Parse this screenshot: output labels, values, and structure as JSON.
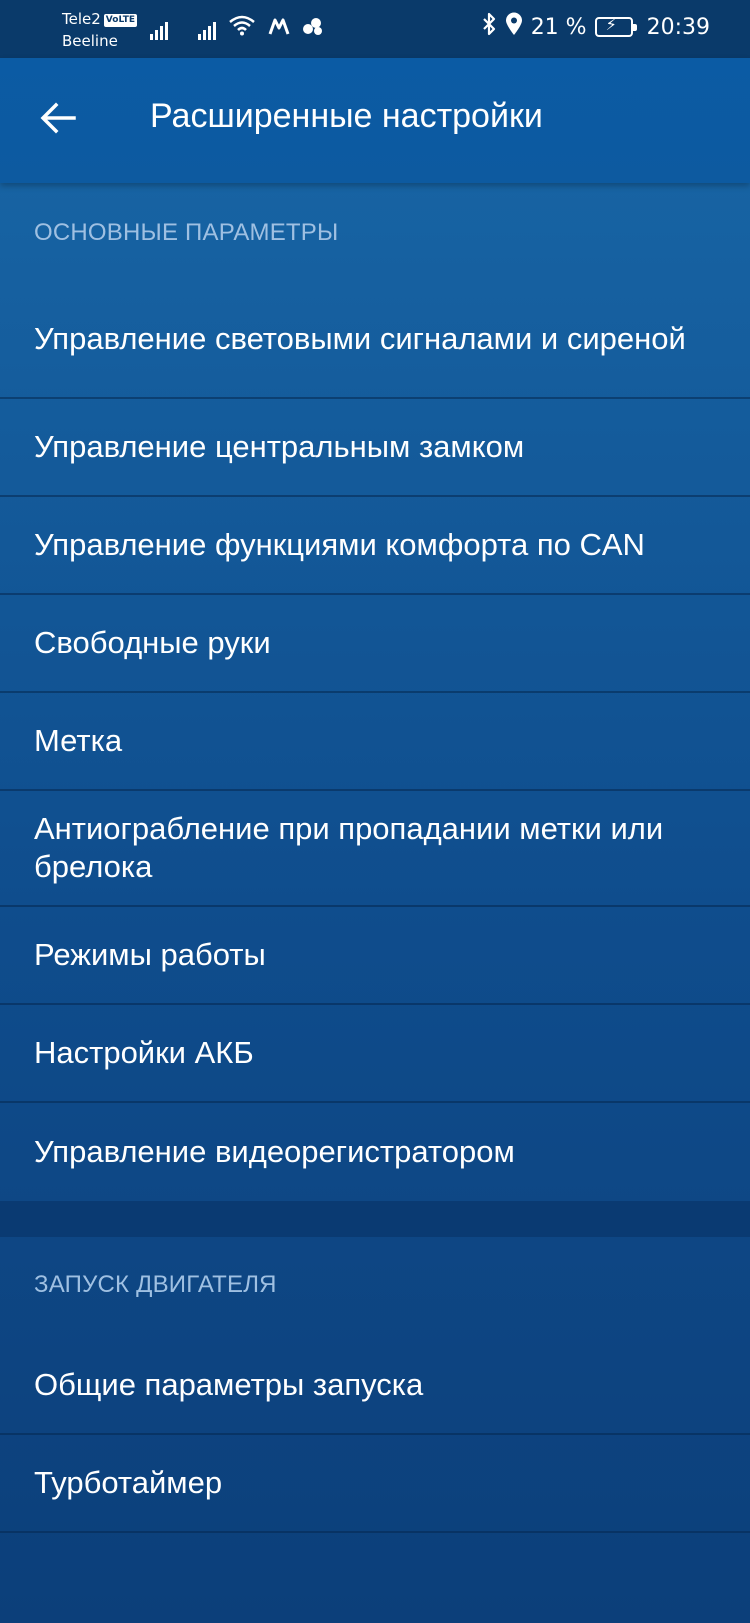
{
  "status_bar": {
    "carrier1": "Tele2",
    "volte": "VoLTE",
    "carrier2": "Beeline",
    "battery_percent": "21 %",
    "time": "20:39",
    "icons": [
      "signal-icon",
      "signal-icon",
      "wifi-icon",
      "m-logo-icon",
      "cloud-icon",
      "bluetooth-icon",
      "location-icon",
      "battery-charging-icon"
    ]
  },
  "appbar": {
    "back_icon": "arrow-left-icon",
    "title": "Расширенные настройки"
  },
  "sections": [
    {
      "header": "ОСНОВНЫЕ ПАРАМЕТРЫ",
      "items": [
        "Управление световыми сигналами и сиреной",
        "Управление центральным замком",
        "Управление функциями комфорта по CAN",
        "Свободные руки",
        "Метка",
        "Антиограбление при пропадании метки или брелока",
        "Режимы работы",
        "Настройки АКБ",
        "Управление видеорегистратором"
      ]
    },
    {
      "header": "ЗАПУСК ДВИГАТЕЛЯ",
      "items": [
        "Общие параметры запуска",
        "Турботаймер"
      ]
    }
  ],
  "colors": {
    "appbar": "#0b5ba4",
    "background": "#1763a3",
    "section_header": "#9fc0e2"
  }
}
